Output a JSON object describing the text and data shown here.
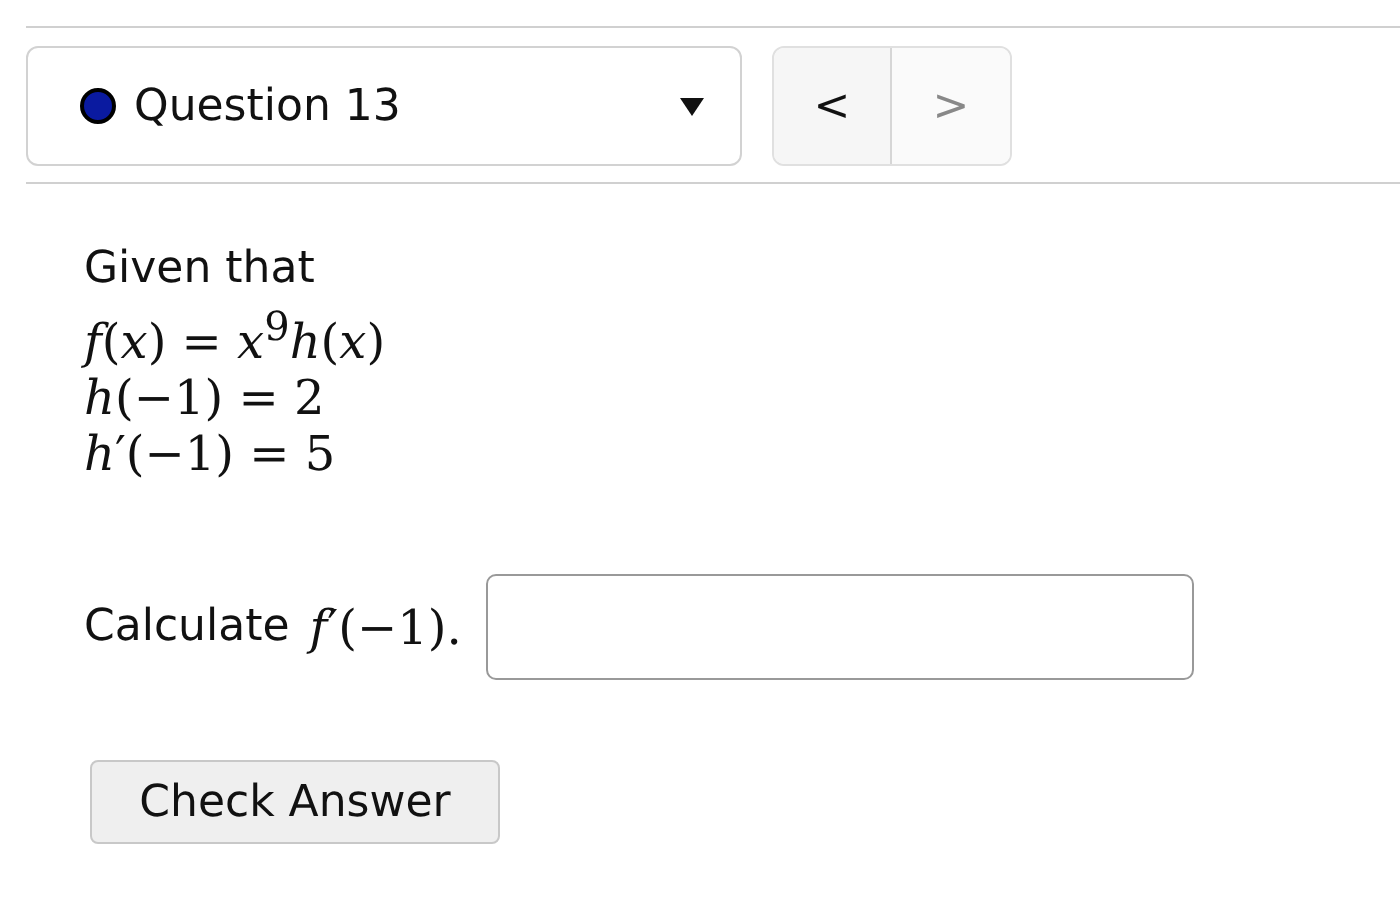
{
  "question_selector": {
    "label": "Question 13",
    "color": "#0a1aa0"
  },
  "navigation": [
    {
      "label": "<",
      "disabled": false
    },
    {
      "label": ">",
      "disabled": true
    }
  ],
  "intro": "Given that",
  "given_lines": [
    "*f*(*x*) = *x*$^{9}$*h*(*x*)",
    "*h*(−1) = 2",
    "*h*′(−1) = 5"
  ],
  "prompt": {
    "text": "Calculate",
    "math": "*f*′(−1)."
  },
  "buttons": [
    "Check Answer"
  ]
}
